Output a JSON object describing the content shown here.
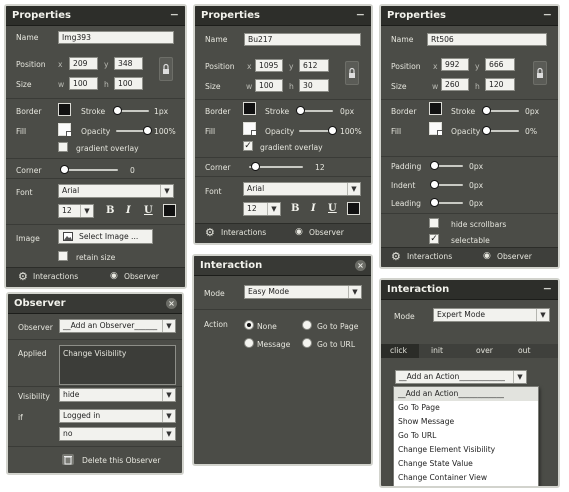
{
  "properties_1": {
    "title": "Properties",
    "collapse": "−",
    "name_label": "Name",
    "name_value": "Img393",
    "position_label": "Position",
    "x_label": "x",
    "x_value": "209",
    "y_label": "y",
    "y_value": "348",
    "size_label": "Size",
    "w_label": "w",
    "w_value": "100",
    "h_label": "h",
    "h_value": "100",
    "border_label": "Border",
    "stroke_label": "Stroke",
    "stroke_value": "1px",
    "stroke_level": 0.0,
    "fill_label": "Fill",
    "opacity_label": "Opacity",
    "opacity_value": "100%",
    "opacity_level": 1.0,
    "gradient_label": "gradient overlay",
    "gradient_checked": false,
    "corner_label": "Corner",
    "corner_value": "0",
    "corner_level": 0.0,
    "font_label": "Font",
    "font_value": "Arial",
    "font_size_value": "12",
    "bold": "B",
    "italic": "I",
    "underline": "U",
    "image_label": "Image",
    "select_image_label": "Select Image ...",
    "retain_size_label": "retain size",
    "interactions_label": "Interactions",
    "observer_label": "Observer"
  },
  "properties_2": {
    "title": "Properties",
    "collapse": "−",
    "name_label": "Name",
    "name_value": "Bu217",
    "position_label": "Position",
    "x_label": "x",
    "x_value": "1095",
    "y_label": "y",
    "y_value": "612",
    "size_label": "Size",
    "w_label": "w",
    "w_value": "100",
    "h_label": "h",
    "h_value": "30",
    "border_label": "Border",
    "stroke_label": "Stroke",
    "stroke_value": "0px",
    "stroke_level": 0.0,
    "fill_label": "Fill",
    "opacity_label": "Opacity",
    "opacity_value": "100%",
    "opacity_level": 1.0,
    "gradient_label": "gradient overlay",
    "gradient_checked": true,
    "corner_label": "Corner",
    "corner_value": "12",
    "corner_level": 0.08,
    "font_label": "Font",
    "font_value": "Arial",
    "font_size_value": "12",
    "bold": "B",
    "italic": "I",
    "underline": "U",
    "interactions_label": "Interactions",
    "observer_label": "Observer"
  },
  "properties_3": {
    "title": "Properties",
    "collapse": "−",
    "name_label": "Name",
    "name_value": "Rt506",
    "position_label": "Position",
    "x_label": "x",
    "x_value": "992",
    "y_label": "y",
    "y_value": "666",
    "size_label": "Size",
    "w_label": "w",
    "w_value": "260",
    "h_label": "h",
    "h_value": "120",
    "border_label": "Border",
    "stroke_label": "Stroke",
    "stroke_value": "0px",
    "stroke_level": 0.0,
    "fill_label": "Fill",
    "opacity_label": "Opacity",
    "opacity_value": "0%",
    "opacity_level": 0.0,
    "padding_label": "Padding",
    "padding_value": "0px",
    "indent_label": "Indent",
    "indent_value": "0px",
    "leading_label": "Leading",
    "leading_value": "0px",
    "hide_scrollbars_label": "hide scrollbars",
    "hide_scrollbars_checked": false,
    "selectable_label": "selectable",
    "selectable_checked": true,
    "interactions_label": "Interactions",
    "observer_label": "Observer"
  },
  "observer": {
    "title": "Observer",
    "close": "×",
    "observer_label": "Observer",
    "observer_value": "__Add an Observer______",
    "applied_label": "Applied",
    "applied_items": [
      "Change Visibility"
    ],
    "visibility_label": "Visibility",
    "visibility_value": "hide",
    "if_label": "if",
    "condition_value": "Logged in",
    "negation_value": "no",
    "delete_label": "Delete this Observer"
  },
  "interaction_1": {
    "title": "Interaction",
    "close": "×",
    "mode_label": "Mode",
    "mode_value": "Easy Mode",
    "action_label": "Action",
    "actions": [
      {
        "label": "None",
        "selected": true
      },
      {
        "label": "Go to Page",
        "selected": false
      },
      {
        "label": "Message",
        "selected": false
      },
      {
        "label": "Go to URL",
        "selected": false
      }
    ]
  },
  "interaction_2": {
    "title": "Interaction",
    "collapse": "−",
    "mode_label": "Mode",
    "mode_value": "Expert Mode",
    "tabs": [
      "click",
      "init",
      "over",
      "out"
    ],
    "active_tab": "click",
    "action_select_value": "__Add an Action____________",
    "dropdown_options": [
      "__Add an Action____________",
      "Go To Page",
      "Show Message",
      "Go To URL",
      "Change Element Visibility",
      "Change State Value",
      "Change Container View"
    ]
  },
  "icons": {
    "gear": "⚙",
    "eye": "◉",
    "lock": "lock",
    "trash": "🗑",
    "image": "image",
    "arrow_down": "▼"
  },
  "colors": {
    "panel_bg": "#4b4c47",
    "header_bg": "#2d2e2a",
    "frame": "#d2d3cd",
    "text": "#e4e4dc",
    "field_bg": "#f2f2ee"
  }
}
